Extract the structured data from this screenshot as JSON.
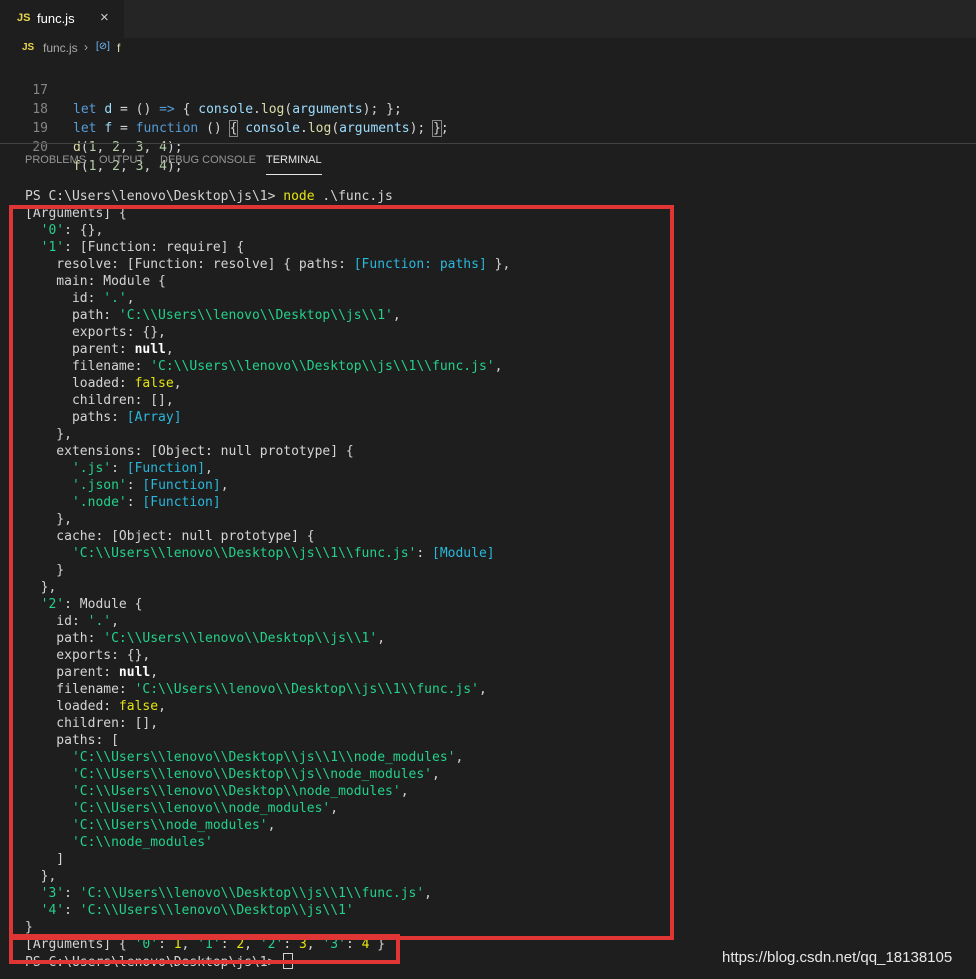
{
  "tab": {
    "icon": "JS",
    "name": "func.js",
    "close": "×"
  },
  "breadcrumb": {
    "icon": "JS",
    "file": "func.js",
    "separator": "›",
    "symbol_icon": "[⊘]",
    "symbol": "f"
  },
  "editor_lines": [
    {
      "num": "17",
      "html_id": "l17"
    },
    {
      "num": "18",
      "html_id": "l18"
    },
    {
      "num": "19",
      "html_id": "l19"
    },
    {
      "num": "20",
      "html_id": "l20"
    }
  ],
  "panel_tabs": [
    "PROBLEMS",
    "OUTPUT",
    "DEBUG CONSOLE",
    "TERMINAL"
  ],
  "active_panel_tab": "TERMINAL",
  "terminal_lines": [
    [
      [
        "PS C:\\Users\\lenovo\\Desktop\\js\\1> ",
        ""
      ],
      [
        "node",
        "y"
      ],
      [
        " .\\func.js",
        ""
      ]
    ],
    [
      [
        "[Arguments] {",
        ""
      ]
    ],
    [
      [
        "  ",
        ""
      ],
      [
        "'0'",
        "s"
      ],
      [
        ": {},",
        ""
      ]
    ],
    [
      [
        "  ",
        ""
      ],
      [
        "'1'",
        "s"
      ],
      [
        ": [Function: require] {",
        ""
      ]
    ],
    [
      [
        "    resolve: [Function: resolve] { paths: ",
        ""
      ],
      [
        "[Function: paths]",
        "c"
      ],
      [
        " },",
        ""
      ]
    ],
    [
      [
        "    main: Module {",
        ""
      ]
    ],
    [
      [
        "      id: ",
        ""
      ],
      [
        "'.'",
        "s"
      ],
      [
        ",",
        ""
      ]
    ],
    [
      [
        "      path: ",
        ""
      ],
      [
        "'C:\\\\Users\\\\lenovo\\\\Desktop\\\\js\\\\1'",
        "s"
      ],
      [
        ",",
        ""
      ]
    ],
    [
      [
        "      exports: {},",
        ""
      ]
    ],
    [
      [
        "      parent: ",
        ""
      ],
      [
        "null",
        "b"
      ],
      [
        ",",
        ""
      ]
    ],
    [
      [
        "      filename: ",
        ""
      ],
      [
        "'C:\\\\Users\\\\lenovo\\\\Desktop\\\\js\\\\1\\\\func.js'",
        "s"
      ],
      [
        ",",
        ""
      ]
    ],
    [
      [
        "      loaded: ",
        ""
      ],
      [
        "false",
        "y"
      ],
      [
        ",",
        ""
      ]
    ],
    [
      [
        "      children: [],",
        ""
      ]
    ],
    [
      [
        "      paths: ",
        ""
      ],
      [
        "[Array]",
        "c"
      ]
    ],
    [
      [
        "    },",
        ""
      ]
    ],
    [
      [
        "    extensions: [Object: null prototype] {",
        ""
      ]
    ],
    [
      [
        "      ",
        ""
      ],
      [
        "'.js'",
        "s"
      ],
      [
        ": ",
        ""
      ],
      [
        "[Function]",
        "c"
      ],
      [
        ",",
        ""
      ]
    ],
    [
      [
        "      ",
        ""
      ],
      [
        "'.json'",
        "s"
      ],
      [
        ": ",
        ""
      ],
      [
        "[Function]",
        "c"
      ],
      [
        ",",
        ""
      ]
    ],
    [
      [
        "      ",
        ""
      ],
      [
        "'.node'",
        "s"
      ],
      [
        ": ",
        ""
      ],
      [
        "[Function]",
        "c"
      ]
    ],
    [
      [
        "    },",
        ""
      ]
    ],
    [
      [
        "    cache: [Object: null prototype] {",
        ""
      ]
    ],
    [
      [
        "      ",
        ""
      ],
      [
        "'C:\\\\Users\\\\lenovo\\\\Desktop\\\\js\\\\1\\\\func.js'",
        "s"
      ],
      [
        ": ",
        ""
      ],
      [
        "[Module]",
        "c"
      ]
    ],
    [
      [
        "    }",
        ""
      ]
    ],
    [
      [
        "  },",
        ""
      ]
    ],
    [
      [
        "  ",
        ""
      ],
      [
        "'2'",
        "s"
      ],
      [
        ": Module {",
        ""
      ]
    ],
    [
      [
        "    id: ",
        ""
      ],
      [
        "'.'",
        "s"
      ],
      [
        ",",
        ""
      ]
    ],
    [
      [
        "    path: ",
        ""
      ],
      [
        "'C:\\\\Users\\\\lenovo\\\\Desktop\\\\js\\\\1'",
        "s"
      ],
      [
        ",",
        ""
      ]
    ],
    [
      [
        "    exports: {},",
        ""
      ]
    ],
    [
      [
        "    parent: ",
        ""
      ],
      [
        "null",
        "b"
      ],
      [
        ",",
        ""
      ]
    ],
    [
      [
        "    filename: ",
        ""
      ],
      [
        "'C:\\\\Users\\\\lenovo\\\\Desktop\\\\js\\\\1\\\\func.js'",
        "s"
      ],
      [
        ",",
        ""
      ]
    ],
    [
      [
        "    loaded: ",
        ""
      ],
      [
        "false",
        "y"
      ],
      [
        ",",
        ""
      ]
    ],
    [
      [
        "    children: [],",
        ""
      ]
    ],
    [
      [
        "    paths: [",
        ""
      ]
    ],
    [
      [
        "      ",
        ""
      ],
      [
        "'C:\\\\Users\\\\lenovo\\\\Desktop\\\\js\\\\1\\\\node_modules'",
        "s"
      ],
      [
        ",",
        ""
      ]
    ],
    [
      [
        "      ",
        ""
      ],
      [
        "'C:\\\\Users\\\\lenovo\\\\Desktop\\\\js\\\\node_modules'",
        "s"
      ],
      [
        ",",
        ""
      ]
    ],
    [
      [
        "      ",
        ""
      ],
      [
        "'C:\\\\Users\\\\lenovo\\\\Desktop\\\\node_modules'",
        "s"
      ],
      [
        ",",
        ""
      ]
    ],
    [
      [
        "      ",
        ""
      ],
      [
        "'C:\\\\Users\\\\lenovo\\\\node_modules'",
        "s"
      ],
      [
        ",",
        ""
      ]
    ],
    [
      [
        "      ",
        ""
      ],
      [
        "'C:\\\\Users\\\\node_modules'",
        "s"
      ],
      [
        ",",
        ""
      ]
    ],
    [
      [
        "      ",
        ""
      ],
      [
        "'C:\\\\node_modules'",
        "s"
      ]
    ],
    [
      [
        "    ]",
        ""
      ]
    ],
    [
      [
        "  },",
        ""
      ]
    ],
    [
      [
        "  ",
        ""
      ],
      [
        "'3'",
        "s"
      ],
      [
        ": ",
        ""
      ],
      [
        "'C:\\\\Users\\\\lenovo\\\\Desktop\\\\js\\\\1\\\\func.js'",
        "s"
      ],
      [
        ",",
        ""
      ]
    ],
    [
      [
        "  ",
        ""
      ],
      [
        "'4'",
        "s"
      ],
      [
        ": ",
        ""
      ],
      [
        "'C:\\\\Users\\\\lenovo\\\\Desktop\\\\js\\\\1'",
        "s"
      ]
    ],
    [
      [
        "}",
        ""
      ]
    ],
    [
      [
        "[Arguments] { ",
        ""
      ],
      [
        "'0'",
        "s"
      ],
      [
        ": ",
        ""
      ],
      [
        "1",
        "y"
      ],
      [
        ", ",
        ""
      ],
      [
        "'1'",
        "s"
      ],
      [
        ": ",
        ""
      ],
      [
        "2",
        "y"
      ],
      [
        ", ",
        ""
      ],
      [
        "'2'",
        "s"
      ],
      [
        ": ",
        ""
      ],
      [
        "3",
        "y"
      ],
      [
        ", ",
        ""
      ],
      [
        "'3'",
        "s"
      ],
      [
        ": ",
        ""
      ],
      [
        "4",
        "y"
      ],
      [
        " }",
        ""
      ]
    ],
    [
      [
        "PS C:\\Users\\lenovo\\Desktop\\js\\1> ",
        ""
      ]
    ]
  ],
  "watermark": "https://blog.csdn.net/qq_18138105",
  "colors": {
    "highlight_box": "#e03535",
    "string": "#23d18b",
    "cyan": "#29b8db",
    "yellow": "#e5e510"
  }
}
